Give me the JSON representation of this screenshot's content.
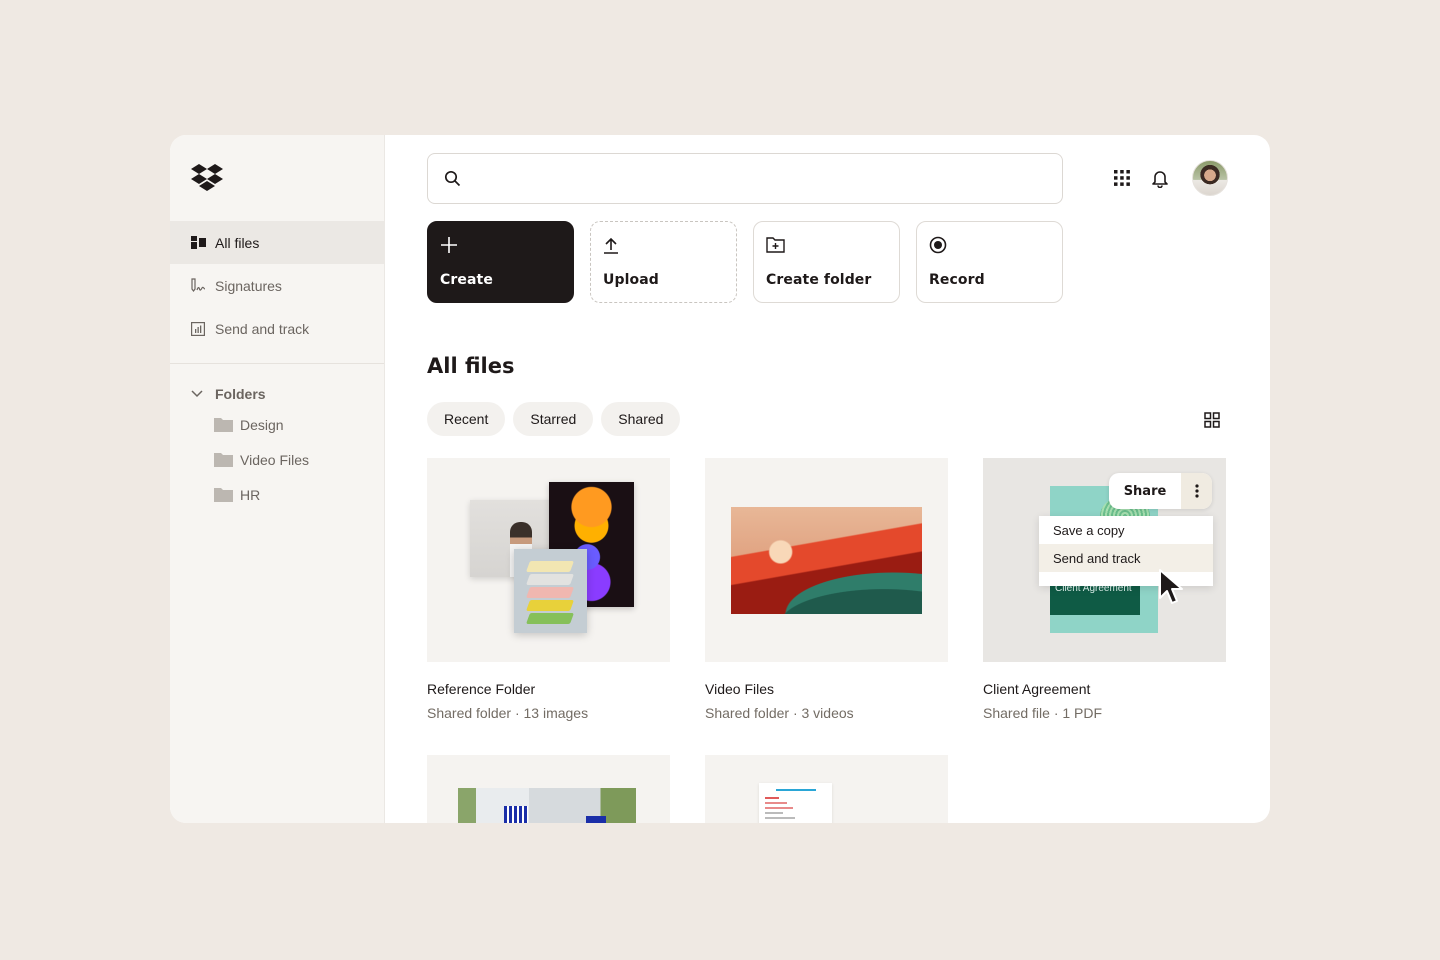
{
  "sidebar": {
    "logo": "dropbox-logo",
    "nav": [
      {
        "label": "All files",
        "icon": "all-files-icon",
        "active": true
      },
      {
        "label": "Signatures",
        "icon": "signature-icon",
        "active": false
      },
      {
        "label": "Send and track",
        "icon": "chart-icon",
        "active": false
      }
    ],
    "folders_label": "Folders",
    "folders": [
      {
        "label": "Design"
      },
      {
        "label": "Video Files"
      },
      {
        "label": "HR"
      }
    ]
  },
  "header": {
    "search_placeholder": "",
    "search_value": ""
  },
  "actions": [
    {
      "label": "Create",
      "icon": "plus-icon"
    },
    {
      "label": "Upload",
      "icon": "upload-icon"
    },
    {
      "label": "Create folder",
      "icon": "folder-plus-icon"
    },
    {
      "label": "Record",
      "icon": "record-icon"
    }
  ],
  "main": {
    "title": "All files",
    "filters": [
      "Recent",
      "Starred",
      "Shared"
    ],
    "cards": [
      {
        "title": "Reference Folder",
        "meta": "Shared folder · 13 images"
      },
      {
        "title": "Video Files",
        "meta": "Shared folder · 3 videos"
      },
      {
        "title": "Client Agreement",
        "meta": "Shared file · 1 PDF",
        "doc_label": "Client Agreement"
      }
    ],
    "share_button": "Share",
    "context_menu": [
      "Save a copy",
      "Send and track"
    ]
  },
  "colors": {
    "background": "#efe9e3",
    "sidebar": "#f7f5f2",
    "primary_button": "#1e1919",
    "doc_teal": "#8fd4c7",
    "doc_green": "#0f5b45"
  }
}
